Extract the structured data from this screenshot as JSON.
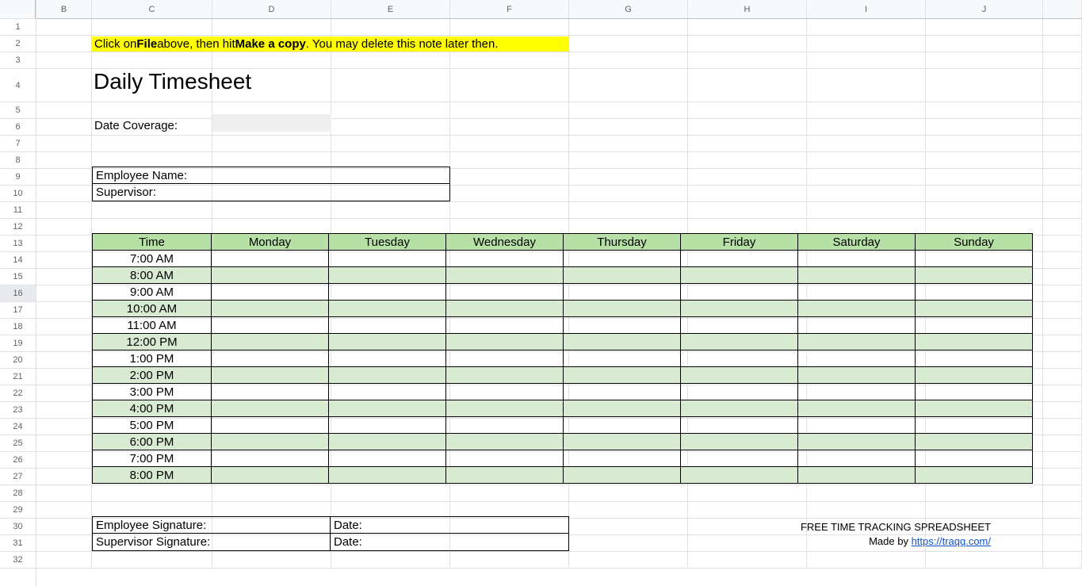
{
  "columns": [
    "B",
    "C",
    "D",
    "E",
    "F",
    "G",
    "H",
    "I",
    "J"
  ],
  "rowCount": 32,
  "tallRow": 4,
  "selectedRow": 16,
  "note": {
    "pre": "Click on ",
    "b1": "File",
    "mid": " above, then hit ",
    "b2": "Make a copy",
    "post": ". You may delete this note later then."
  },
  "title": "Daily Timesheet",
  "dateCoverageLabel": "Date Coverage:",
  "dateCoverageValue": "",
  "employeeNameLabel": "Employee Name:",
  "supervisorLabel": "Supervisor:",
  "timesheet": {
    "headerTime": "Time",
    "days": [
      "Monday",
      "Tuesday",
      "Wednesday",
      "Thursday",
      "Friday",
      "Saturday",
      "Sunday"
    ],
    "times": [
      "7:00 AM",
      "8:00 AM",
      "9:00 AM",
      "10:00 AM",
      "11:00 AM",
      "12:00 PM",
      "1:00 PM",
      "2:00 PM",
      "3:00 PM",
      "4:00 PM",
      "5:00 PM",
      "6:00 PM",
      "7:00 PM",
      "8:00 PM"
    ]
  },
  "signatures": {
    "empSig": "Employee Signature:",
    "supSig": "Supervisor Signature:",
    "date": "Date:"
  },
  "footer": {
    "line1": "FREE TIME TRACKING SPREADSHEET",
    "madeBy": "Made by ",
    "linkText": "https://traqq.com/"
  }
}
